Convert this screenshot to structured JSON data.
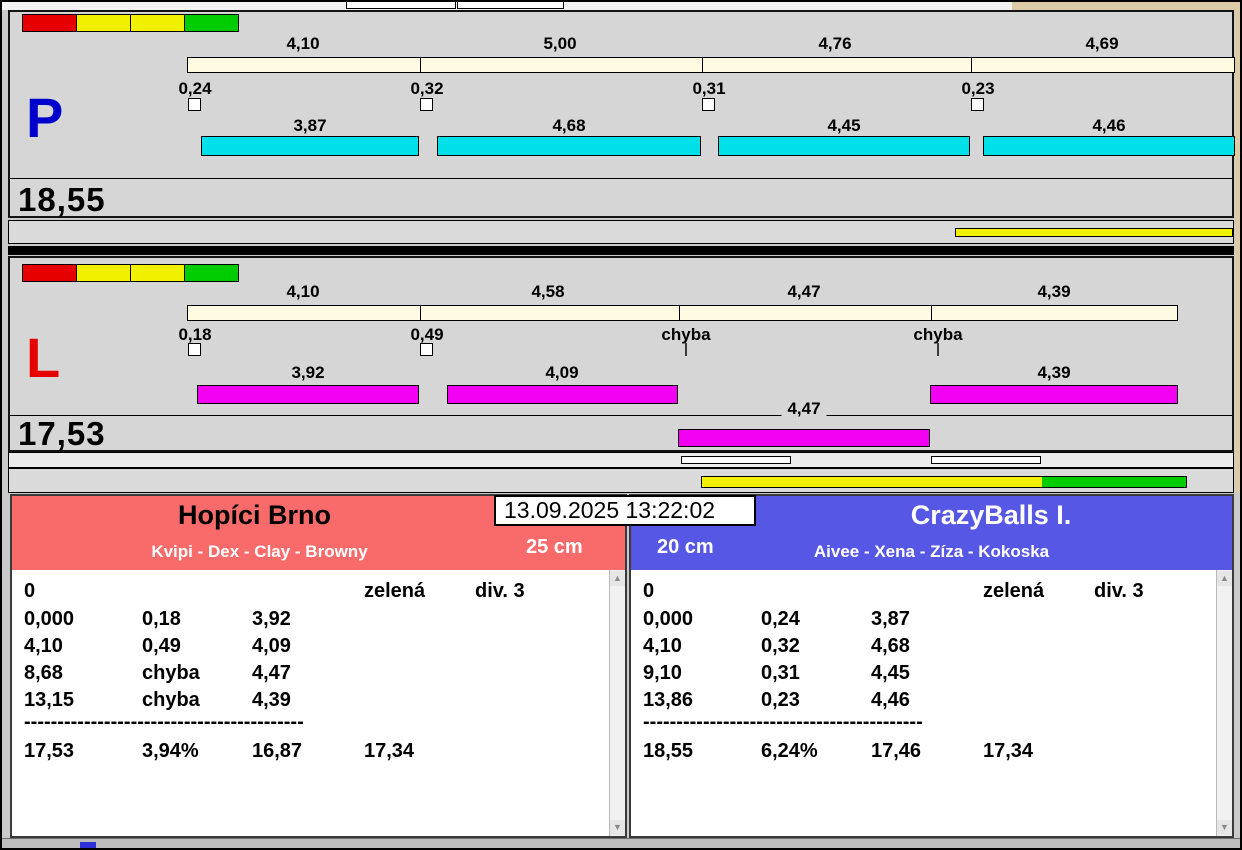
{
  "colors": {
    "red": "#e60000",
    "yellow": "#f0f000",
    "green": "#00cc00",
    "cyan": "#00e0e8",
    "magenta": "#f200f2",
    "cream": "#fffbe2",
    "left_header": "#f96a6a",
    "right_header": "#5757e6",
    "blue_letter": "#0000cd",
    "red_letter": "#e60000"
  },
  "clock": "13.09.2025 13:22:02",
  "p_lane": {
    "letter": "P",
    "total": "18,55",
    "split_times": [
      "4,10",
      "5,00",
      "4,76",
      "4,69"
    ],
    "start_times": [
      "0,24",
      "0,32",
      "0,31",
      "0,23"
    ],
    "dog_times": [
      "3,87",
      "4,68",
      "4,45",
      "4,46"
    ]
  },
  "l_lane": {
    "letter": "L",
    "total": "17,53",
    "split_times": [
      "4,10",
      "4,58",
      "4,47",
      "4,39"
    ],
    "start_times": [
      "0,18",
      "0,49",
      "chyba",
      "chyba"
    ],
    "dog_times": [
      "3,92",
      "4,09",
      "4,39"
    ],
    "extra_dog_time": "4,47"
  },
  "left_team": {
    "name": "Hopíci Brno",
    "dogs": "Kvipi - Dex - Clay - Browny",
    "jump_height": "25 cm",
    "run_header": {
      "run": "0",
      "light": "zelená",
      "division": "div. 3"
    },
    "rows": [
      [
        "0,000",
        "0,18",
        "3,92"
      ],
      [
        "4,10",
        "0,49",
        "4,09"
      ],
      [
        "8,68",
        "chyba",
        "4,47"
      ],
      [
        "13,15",
        "chyba",
        "4,39"
      ]
    ],
    "separator": "------------------------------------------",
    "summary": [
      "17,53",
      "3,94%",
      "16,87",
      "17,34"
    ]
  },
  "right_team": {
    "name": "CrazyBalls I.",
    "dogs": "Aivee - Xena - Zíza - Kokoska",
    "jump_height": "20 cm",
    "run_header": {
      "run": "0",
      "light": "zelená",
      "division": "div. 3"
    },
    "rows": [
      [
        "0,000",
        "0,24",
        "3,87"
      ],
      [
        "4,10",
        "0,32",
        "4,68"
      ],
      [
        "9,10",
        "0,31",
        "4,45"
      ],
      [
        "13,86",
        "0,23",
        "4,46"
      ]
    ],
    "separator": "------------------------------------------",
    "summary": [
      "18,55",
      "6,24%",
      "17,46",
      "17,34"
    ]
  }
}
